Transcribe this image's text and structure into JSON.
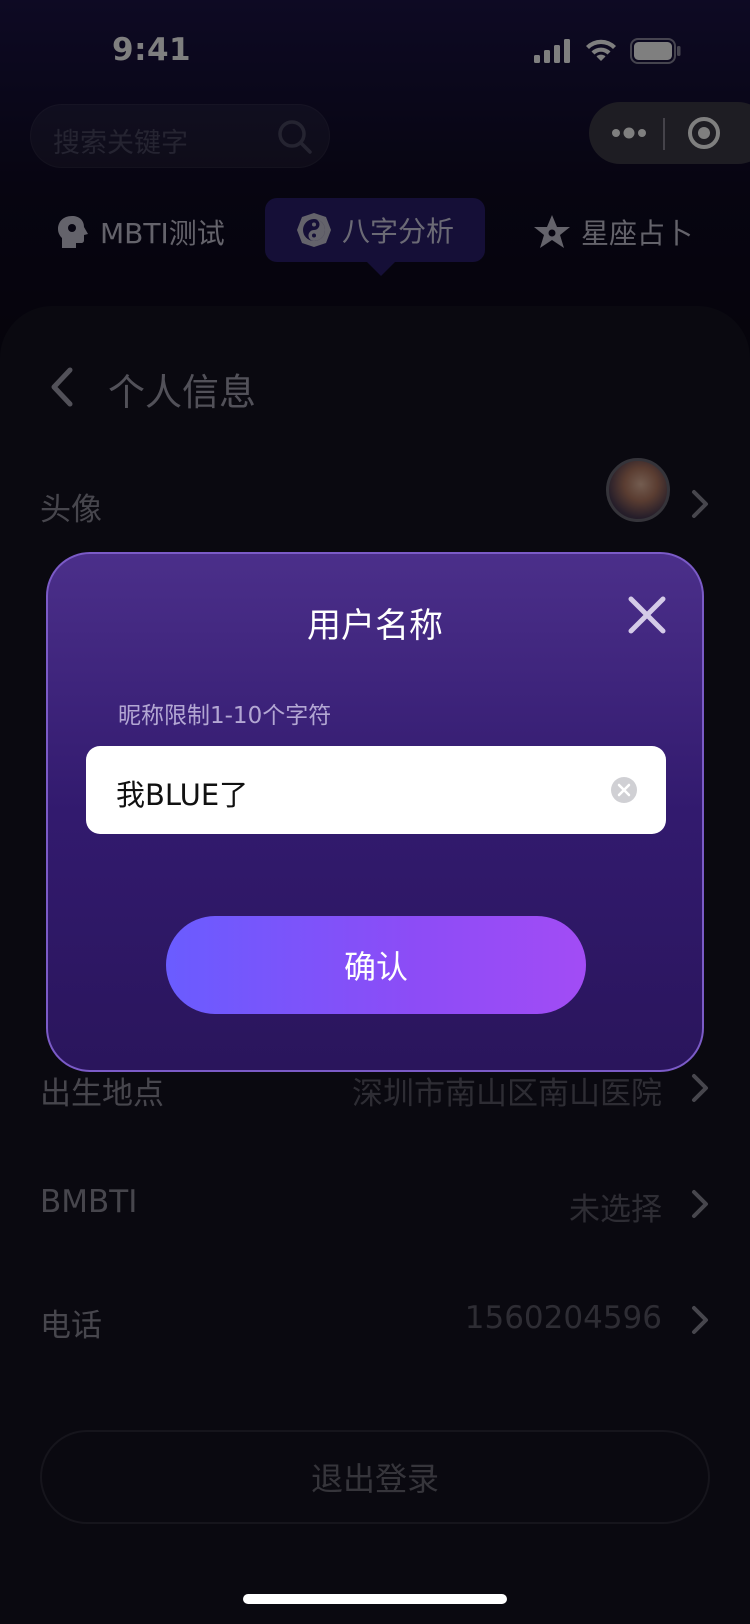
{
  "status": {
    "time": "9:41"
  },
  "search": {
    "placeholder": "搜索关键字"
  },
  "tabs": [
    {
      "label": "MBTI测试",
      "icon": "head-icon"
    },
    {
      "label": "八字分析",
      "icon": "yin-yang-icon",
      "active": true
    },
    {
      "label": "星座占卜",
      "icon": "star-icon"
    }
  ],
  "page": {
    "title": "个人信息"
  },
  "rows": [
    {
      "label": "头像",
      "value": ""
    },
    {
      "label": "出生地点",
      "value": "深圳市南山区南山医院"
    },
    {
      "label": "BMBTI",
      "value": "未选择"
    },
    {
      "label": "电话",
      "value": "1560204596"
    }
  ],
  "logout_label": "退出登录",
  "modal": {
    "title": "用户名称",
    "hint": "昵称限制1-10个字符",
    "input_value": "我BLUE了",
    "confirm_label": "确认"
  },
  "colors": {
    "modal_top": "#4b2f8a",
    "modal_bottom": "#2a155c",
    "button_start": "#6a5cff",
    "button_end": "#a24cf5",
    "active_tab": "#2a1f6e"
  }
}
